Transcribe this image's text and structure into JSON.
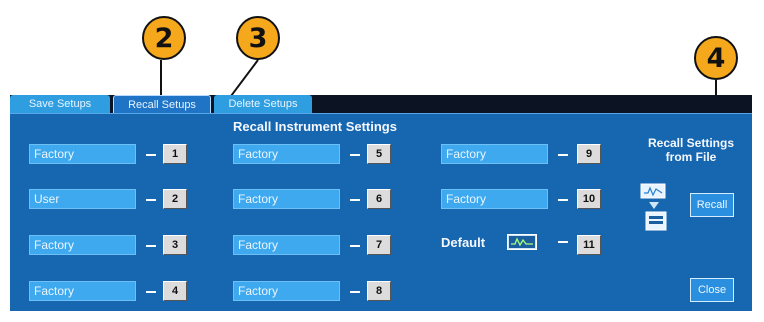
{
  "callouts": [
    "2",
    "3",
    "4"
  ],
  "tabs": [
    "Save Setups",
    "Recall Setups",
    "Delete Setups"
  ],
  "panel": {
    "title": "Recall Instrument Settings",
    "slots": [
      {
        "label": "Factory",
        "num": "1"
      },
      {
        "label": "User",
        "num": "2"
      },
      {
        "label": "Factory",
        "num": "3"
      },
      {
        "label": "Factory",
        "num": "4"
      },
      {
        "label": "Factory",
        "num": "5"
      },
      {
        "label": "Factory",
        "num": "6"
      },
      {
        "label": "Factory",
        "num": "7"
      },
      {
        "label": "Factory",
        "num": "8"
      },
      {
        "label": "Factory",
        "num": "9"
      },
      {
        "label": "Factory",
        "num": "10"
      }
    ],
    "default_label": "Default",
    "default_num": "11",
    "file_title": "Recall Settings from File",
    "recall_button": "Recall",
    "close_button": "Close"
  },
  "icons": {
    "default": "waveform-icon",
    "file": "file-transfer-icon"
  },
  "colors": {
    "panel": "#1666b0",
    "tab": "#2f9ee0",
    "callout": "#f6a81c"
  }
}
